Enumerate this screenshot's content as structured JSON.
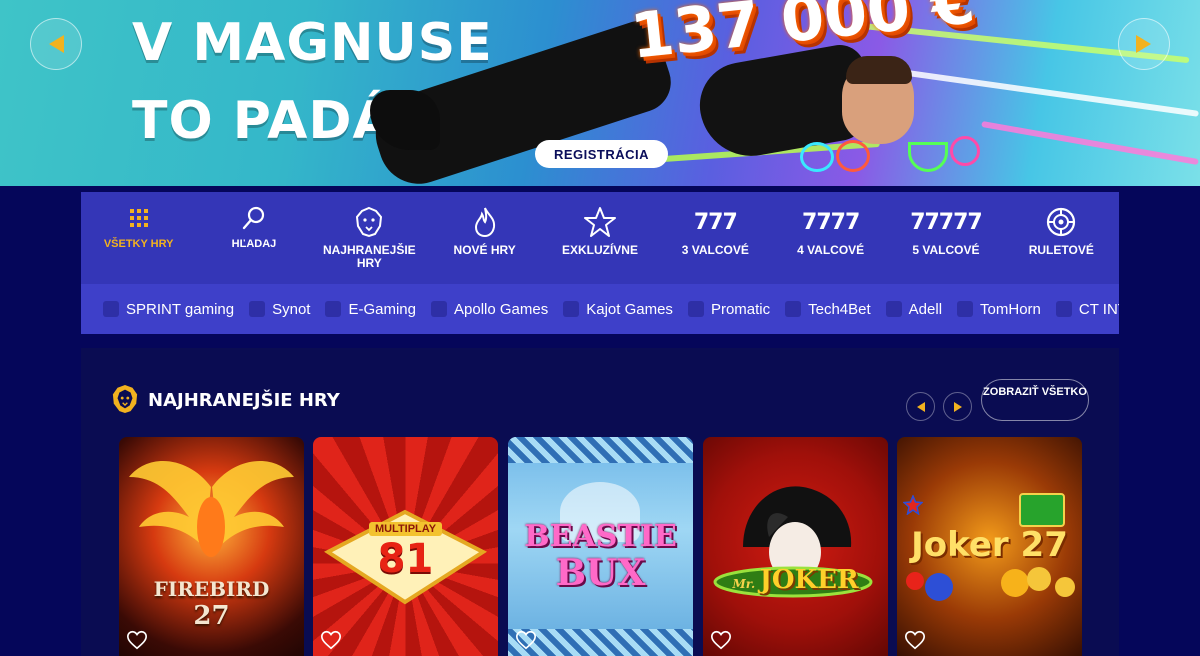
{
  "hero": {
    "title_line1": "V MAGNUSE",
    "title_line2": "TO PADÁ",
    "jackpot": "137 000 €",
    "register_button": "REGISTRÁCIA",
    "prev_icon": "arrow-left-icon",
    "next_icon": "arrow-right-icon"
  },
  "categories": [
    {
      "label": "VŠETKY HRY",
      "icon": "grid-icon",
      "active": true
    },
    {
      "label": "HĽADAJ",
      "icon": "search-icon"
    },
    {
      "label": "NAJHRANEJŠIE HRY",
      "icon": "lion-icon"
    },
    {
      "label": "NOVÉ HRY",
      "icon": "flame-icon"
    },
    {
      "label": "EXKLUZÍVNE",
      "icon": "star-icon"
    },
    {
      "label": "3 VALCOVÉ",
      "icon_text": "777"
    },
    {
      "label": "4 VALCOVÉ",
      "icon_text": "7777"
    },
    {
      "label": "5 VALCOVÉ",
      "icon_text": "77777"
    },
    {
      "label": "RULETOVÉ",
      "icon": "roulette-icon"
    }
  ],
  "providers": [
    "SPRINT gaming",
    "Synot",
    "E-Gaming",
    "Apollo Games",
    "Kajot Games",
    "Promatic",
    "Tech4Bet",
    "Adell",
    "TomHorn",
    "CT INTERACTIVE"
  ],
  "section": {
    "title": "NAJHRANEJŠIE HRY",
    "show_all": "ZOBRAZIŤ VŠETKO"
  },
  "games": [
    {
      "title_line1": "FIREBIRD",
      "title_line2": "27"
    },
    {
      "title_line1": "MULTIPLAY",
      "title_line2": "81"
    },
    {
      "title_line1": "BEASTIE",
      "title_line2": "BUX"
    },
    {
      "title_line1": "Mr.",
      "title_line2": "JOKER"
    },
    {
      "title_line1": "Joker",
      "title_line2": "27"
    }
  ],
  "colors": {
    "accent": "#f2b21f",
    "nav": "#3436b7",
    "background": "#05065a"
  }
}
